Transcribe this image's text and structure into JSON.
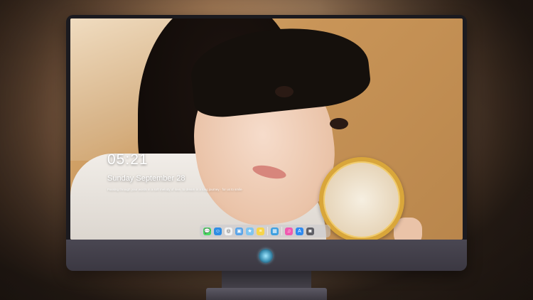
{
  "lockscreen": {
    "time": "05:21",
    "date": "Sunday September 28",
    "quote": "Passing through your words in a soft melody of love, to dream in a long journey · for us to smile"
  },
  "dock": {
    "items": [
      {
        "name": "messages-icon",
        "color": "#4cd964",
        "glyph": "💬"
      },
      {
        "name": "finder-icon",
        "color": "#2f8de4",
        "glyph": "☺"
      },
      {
        "name": "safari-icon",
        "color": "#f2f2f2",
        "glyph": "◎"
      },
      {
        "name": "preview-icon",
        "color": "#5aa4e8",
        "glyph": "▣"
      },
      {
        "name": "imovie-icon",
        "color": "#7fc4ef",
        "glyph": "★"
      },
      {
        "name": "notes-icon",
        "color": "#f7d54b",
        "glyph": "≡"
      },
      {
        "name": "photo-booth-icon",
        "color": "#3fa0e0",
        "glyph": "▦"
      },
      {
        "name": "music-icon",
        "color": "#f05ab0",
        "glyph": "♫"
      },
      {
        "name": "app-store-icon",
        "color": "#2e8af0",
        "glyph": "A"
      },
      {
        "name": "camera-icon",
        "color": "#5f5f66",
        "glyph": "◙"
      }
    ]
  },
  "colors": {
    "bezel": "#1b1a1f",
    "chin": "#3b3842",
    "logo_glow": "#9fe7ff"
  }
}
